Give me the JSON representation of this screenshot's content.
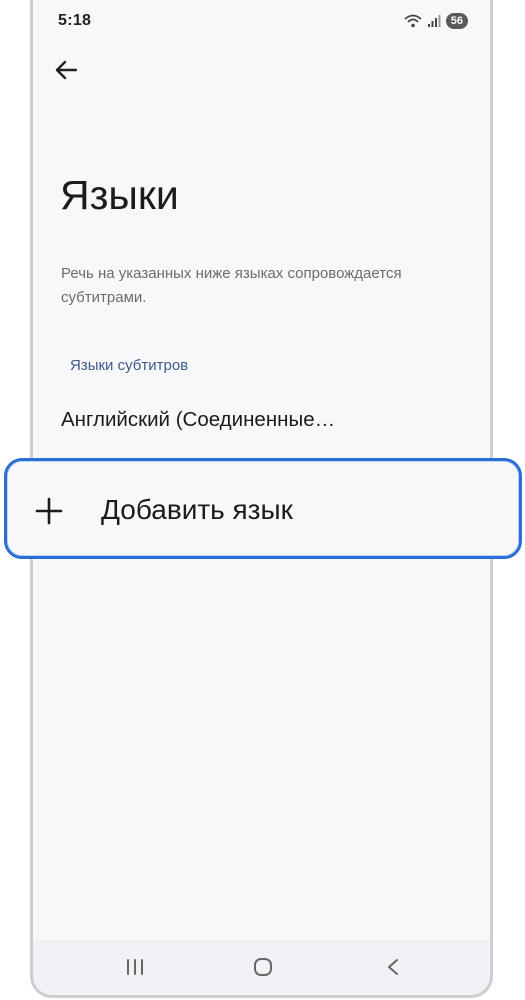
{
  "status_bar": {
    "time": "5:18",
    "battery_level": "56",
    "icons": [
      "wifi-icon",
      "signal-icon",
      "battery-icon"
    ]
  },
  "header": {
    "back_icon": "arrow-left-icon",
    "title": "Языки"
  },
  "description": "Речь на указанных ниже языках сопровождается субтитрами.",
  "section": {
    "header": "Языки субтитров",
    "items": [
      {
        "label": "Английский (Соединенные…"
      }
    ]
  },
  "add_language": {
    "icon": "plus-icon",
    "label": "Добавить язык"
  },
  "navigation_bar": {
    "buttons": [
      "recent-apps-icon",
      "home-icon",
      "back-icon"
    ]
  },
  "colors": {
    "accent": "#2b6fd6",
    "section_header": "#3e5a8a",
    "background": "#f8f8fb"
  }
}
